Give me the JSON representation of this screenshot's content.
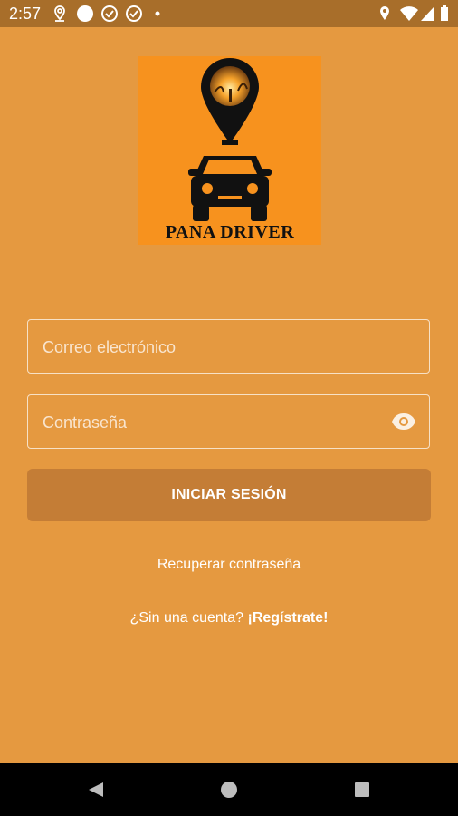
{
  "status_bar": {
    "time": "2:57",
    "left_icons": [
      "location-pin-icon",
      "circle-icon",
      "check-circle-icon",
      "check-circle-icon",
      "dot-icon"
    ],
    "right_icons": [
      "location-icon",
      "wifi-icon",
      "signal-icon",
      "battery-icon"
    ]
  },
  "logo": {
    "brand_text": "PANA DRIVER"
  },
  "form": {
    "email_placeholder": "Correo electrónico",
    "email_value": "",
    "password_placeholder": "Contraseña",
    "password_value": "",
    "login_label": "INICIAR SESIÓN"
  },
  "links": {
    "recover_password": "Recuperar contraseña",
    "no_account_prefix": "¿Sin una cuenta?",
    "register": "¡Regístrate!"
  },
  "colors": {
    "background": "#E59940",
    "status_bar": "#A86E2A",
    "button": "#C47D36",
    "logo_bg": "#F7921E"
  },
  "nav_bar": {
    "buttons": [
      "back-icon",
      "home-icon",
      "recents-icon"
    ]
  }
}
